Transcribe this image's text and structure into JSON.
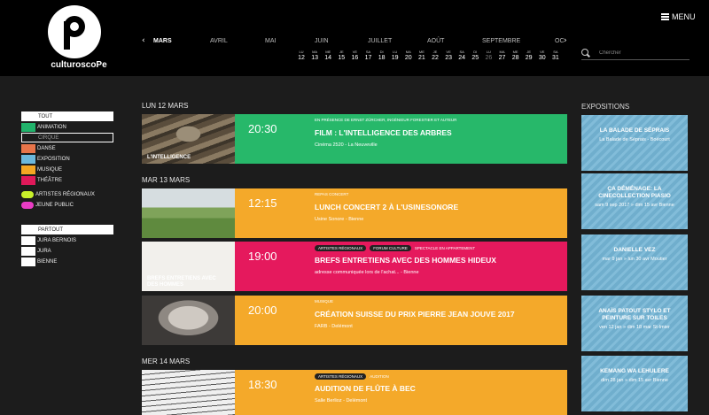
{
  "logo": {
    "wordmark": "culturoscoPe"
  },
  "menu": {
    "label": "MENU"
  },
  "calendar": {
    "months": [
      "MARS",
      "AVRIL",
      "MAI",
      "JUIN",
      "JUILLET",
      "AOÛT",
      "SEPTEMBRE",
      "OC"
    ],
    "active_month": "MARS",
    "days": [
      {
        "name": "LU",
        "num": "12"
      },
      {
        "name": "MA",
        "num": "13"
      },
      {
        "name": "ME",
        "num": "14"
      },
      {
        "name": "JE",
        "num": "15"
      },
      {
        "name": "VE",
        "num": "16"
      },
      {
        "name": "SA",
        "num": "17"
      },
      {
        "name": "DI",
        "num": "18"
      },
      {
        "name": "LU",
        "num": "19"
      },
      {
        "name": "MA",
        "num": "20"
      },
      {
        "name": "ME",
        "num": "21"
      },
      {
        "name": "JE",
        "num": "22"
      },
      {
        "name": "VE",
        "num": "23"
      },
      {
        "name": "SA",
        "num": "24"
      },
      {
        "name": "DI",
        "num": "25"
      },
      {
        "name": "LU",
        "num": "26"
      },
      {
        "name": "MA",
        "num": "27"
      },
      {
        "name": "ME",
        "num": "28"
      },
      {
        "name": "JE",
        "num": "29"
      },
      {
        "name": "VE",
        "num": "30"
      },
      {
        "name": "SA",
        "num": "31"
      }
    ],
    "dim_day": "26",
    "prev_arrow": "‹",
    "next_arrow": "›"
  },
  "search": {
    "placeholder": "Chercher"
  },
  "filters_categories": [
    {
      "label": "TOUT",
      "kind": "header"
    },
    {
      "label": "ANIMATION",
      "color": "#21b36b"
    },
    {
      "label": "CIRQUE",
      "kind": "header-dark"
    },
    {
      "label": "DANSE",
      "color": "#e8754a"
    },
    {
      "label": "EXPOSITION",
      "color": "#6cb8dc"
    },
    {
      "label": "MUSIQUE",
      "color": "#f5a623"
    },
    {
      "label": "THÉÂTRE",
      "color": "#e0195a"
    }
  ],
  "filters_special": [
    {
      "label": "ARTISTES RÉGIONAUX",
      "color": "#c8f02a"
    },
    {
      "label": "JEUNE PUBLIC",
      "color": "#e93cc4"
    }
  ],
  "filters_places": [
    {
      "label": "PARTOUT",
      "kind": "header"
    },
    {
      "label": "JURA BERNOIS"
    },
    {
      "label": "JURA"
    },
    {
      "label": "BIENNE"
    }
  ],
  "days": [
    "LUN 12 MARS",
    "MAR 13 MARS",
    "MER 14 MARS"
  ],
  "events": [
    {
      "time": "20:30",
      "category": "EN PRÉSENCE DE ERNST ZÜRCHER, INGÉNIEUR FORESTIER ET AUTEUR",
      "tags": [],
      "title": "FILM : L'INTELLIGENCE DES ARBRES",
      "location": "Cinéma 2520 - La Neuveville",
      "color": "#27b86a",
      "thumb_caption": "L'INTELLIGENCE"
    },
    {
      "time": "12:15",
      "category": "REPAS CONCERT",
      "tags": [],
      "title": "LUNCH CONCERT 2 À L'USINESONORE",
      "location": "Usine Sonore - Bienne",
      "color": "#f4a92a",
      "thumb_caption": ""
    },
    {
      "time": "19:00",
      "category": "SPECTACLE EN APPARTEMENT",
      "tags": [
        "ARTISTES RÉGIONAUX",
        "FORUM CULTURE"
      ],
      "title": "BREFS ENTRETIENS AVEC DES HOMMES HIDEUX",
      "location": "adresse communiquée lors de l'achat... - Bienne",
      "color": "#e5195d",
      "thumb_caption": "BREFS ENTRETIENS AVEC DES HOMMES"
    },
    {
      "time": "20:00",
      "category": "MUSIQUE",
      "tags": [],
      "title": "CRÉATION SUISSE DU PRIX PIERRE JEAN JOUVE 2017",
      "location": "FARB - Delémont",
      "color": "#f4a92a",
      "thumb_caption": ""
    },
    {
      "time": "18:30",
      "category": "AUDITION",
      "tags": [
        "ARTISTES RÉGIONAUX"
      ],
      "title": "AUDITION DE FLÛTE À BEC",
      "location": "Salle Berlioz - Delémont",
      "color": "#f4a92a",
      "thumb_caption": ""
    }
  ],
  "expositions": {
    "title": "EXPOSITIONS",
    "items": [
      {
        "title": "LA BALADE DE SÉPRAIS",
        "detail": "La Balade de Séprais  -  Boécourt"
      },
      {
        "title": "ÇA DÉMÉNAGE: LA CINECOLLECTION PIASIO",
        "detail": "sam 9 sep 2017 » dim 15 avr  Bienne"
      },
      {
        "title": "DANIELLE VEZ",
        "detail": "mar 9 jan » lun 30 avr  Moutier"
      },
      {
        "title": "ANAÏS PATOUT STYLO ET PEINTURE SUR TOILES",
        "detail": "ven 12 jan » dim 18 mar  St-Imier"
      },
      {
        "title": "KEMANG WA LEHULERE",
        "detail": "dim 28 jan » dim 15 avr  Bienne"
      }
    ]
  }
}
